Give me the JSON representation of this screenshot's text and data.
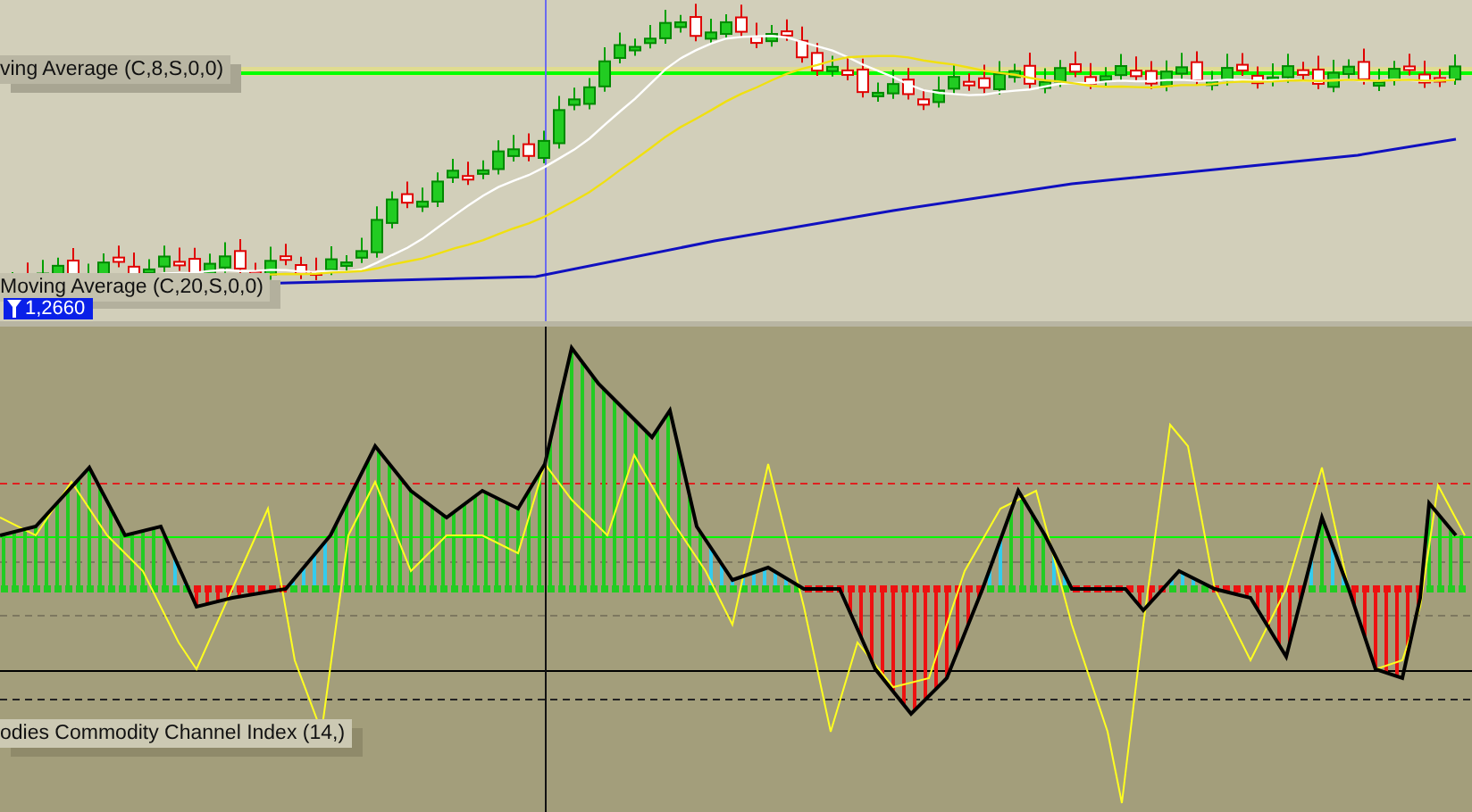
{
  "price_panel": {
    "labels": [
      {
        "text": "ving Average (C,8,S,0,0)"
      },
      {
        "text": "Moving Average (C,20,S,0,0)"
      }
    ],
    "price_flag": "1,2660"
  },
  "indicator_panel": {
    "label": "odies Commodity Channel Index (14,)"
  }
}
